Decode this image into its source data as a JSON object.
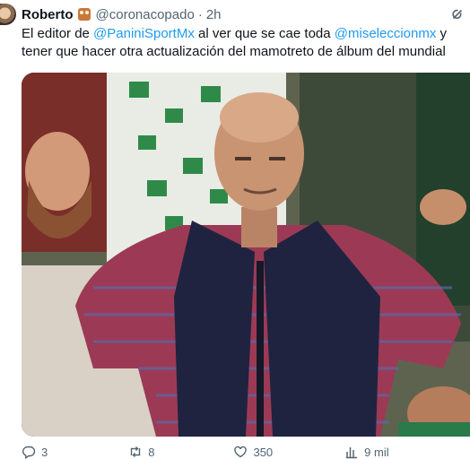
{
  "tweet": {
    "author_name": "Roberto",
    "author_badge": "owl-emoji",
    "handle": "@coronacopado",
    "separator": "·",
    "time": "2h",
    "text_part1": "El editor de ",
    "mention1": "@PaniniSportMx",
    "text_part2": " al ver que se cae toda ",
    "mention2": "@miseleccionmx",
    "text_part3": " y tener que hacer otra actualización del mamotreto de álbum del mundial",
    "media_description_icon": "photo"
  },
  "actions": {
    "replies": "3",
    "retweets": "8",
    "likes": "350",
    "views": "9 mil"
  },
  "colors": {
    "text": "#0f1419",
    "secondary": "#536471",
    "mention": "#1d9bf0"
  }
}
